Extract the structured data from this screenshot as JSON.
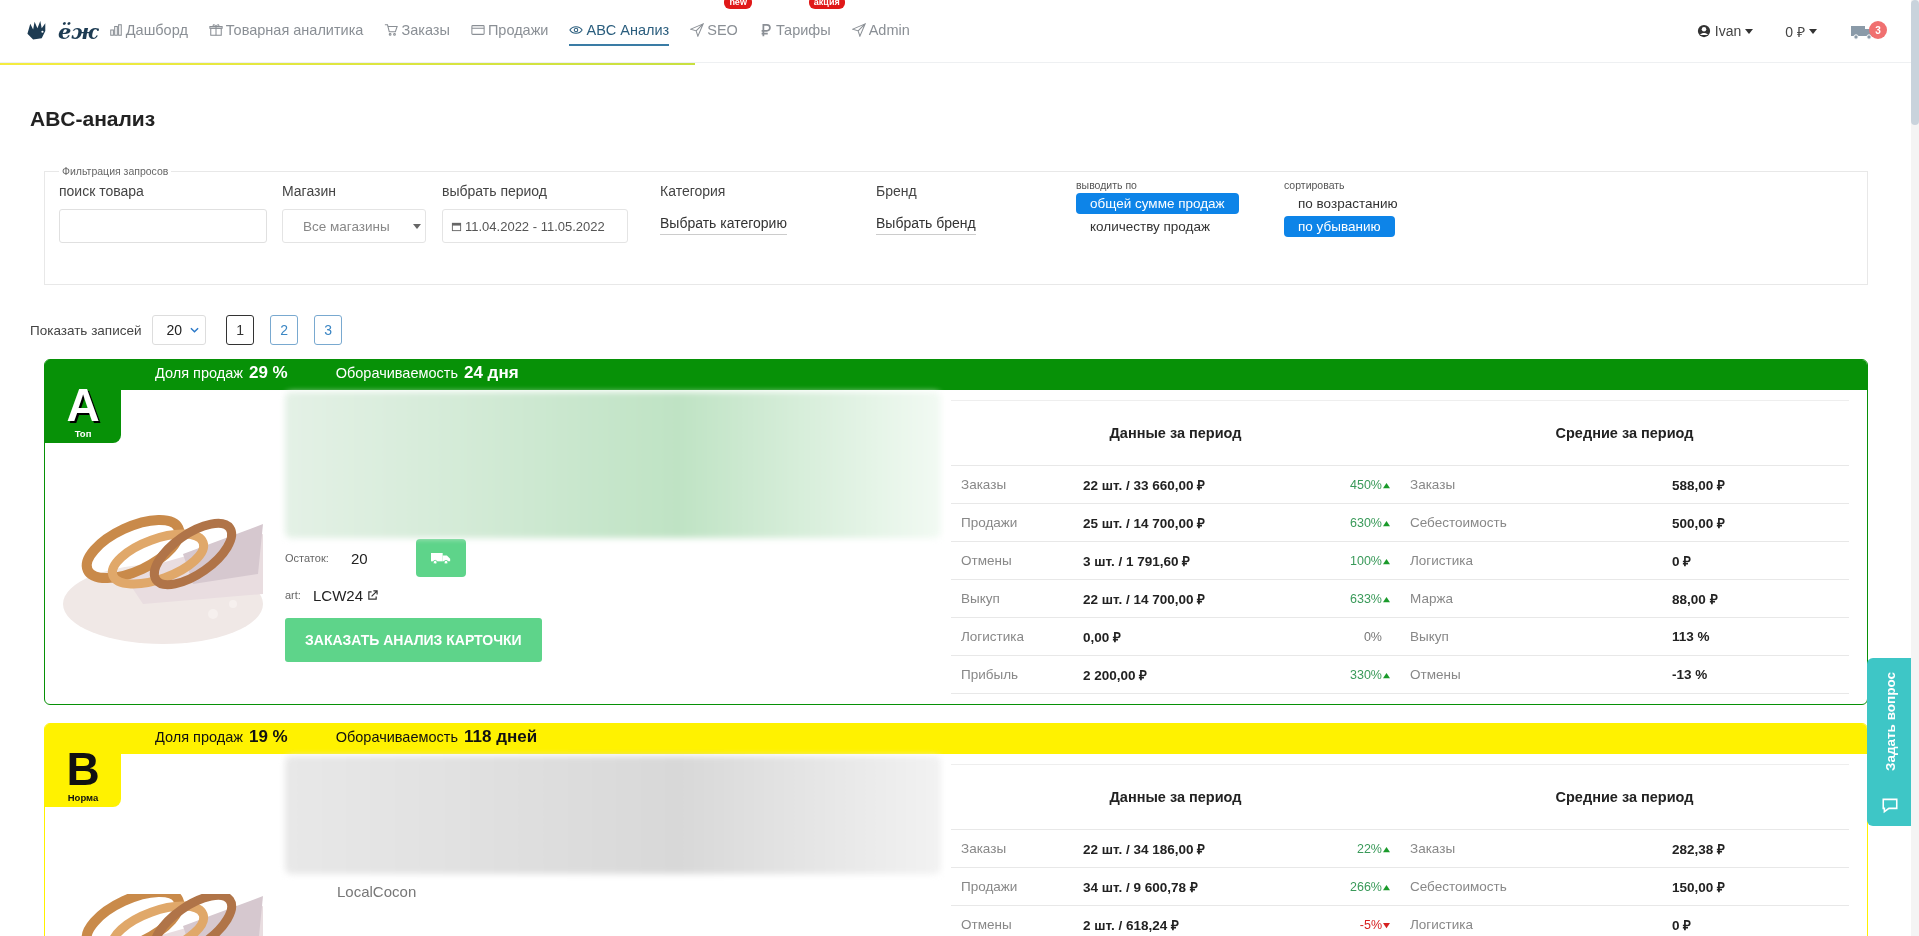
{
  "nav": {
    "items": [
      {
        "label": "Дашборд",
        "selected": false
      },
      {
        "label": "Товарная аналитика",
        "selected": false
      },
      {
        "label": "Заказы",
        "selected": false
      },
      {
        "label": "Продажи",
        "selected": false
      },
      {
        "label": "ABC Анализ",
        "selected": true
      },
      {
        "label": "SEO",
        "selected": false,
        "badge": "new"
      },
      {
        "label": "Тарифы",
        "selected": false,
        "badge": "акция"
      },
      {
        "label": "Admin",
        "selected": false
      }
    ],
    "logo": "ёж",
    "user": "Ivan",
    "balance": "0 ₽",
    "cart_count": "3"
  },
  "page_title": "ABC-анализ",
  "filters": {
    "legend": "Фильтрация запросов",
    "search": {
      "label": "поиск товара"
    },
    "store": {
      "label": "Магазин",
      "value": "Все магазины"
    },
    "period": {
      "label": "выбрать период",
      "value": "11.04.2022 - 11.05.2022"
    },
    "category": {
      "label": "Категория",
      "value": "Выбрать категорию"
    },
    "brand": {
      "label": "Бренд",
      "value": "Выбрать бренд"
    },
    "output": {
      "label": "выводить по",
      "options": [
        {
          "label": "общей сумме продаж",
          "selected": true
        },
        {
          "label": "количеству продаж",
          "selected": false
        }
      ]
    },
    "sort": {
      "label": "сортировать",
      "options": [
        {
          "label": "по возрастанию",
          "selected": false
        },
        {
          "label": "по убыванию",
          "selected": true
        }
      ]
    }
  },
  "pagination": {
    "label": "Показать записей",
    "page_size": "20",
    "pages": [
      {
        "label": "1",
        "selected": true
      },
      {
        "label": "2",
        "selected": false
      },
      {
        "label": "3",
        "selected": false
      }
    ]
  },
  "cards": [
    {
      "grade": "A",
      "grade_label": "Топ",
      "color": "#079107",
      "share_label": "Доля продаж",
      "share": "29 %",
      "turnover_label": "Оборачиваемость",
      "turnover": "24 дня",
      "stock_label": "Остаток:",
      "stock": "20",
      "art_label": "art:",
      "art": "LCW24",
      "order_button": "ЗАКАЗАТЬ АНАЛИЗ КАРТОЧКИ",
      "period": {
        "title": "Данные за период",
        "rows": [
          {
            "label": "Заказы",
            "value": "22 шт. / 33 660,00 ₽",
            "change": "450%",
            "kind": "up"
          },
          {
            "label": "Продажи",
            "value": "25 шт. / 14 700,00 ₽",
            "change": "630%",
            "kind": "up"
          },
          {
            "label": "Отмены",
            "value": "3 шт. / 1 791,60 ₽",
            "change": "100%",
            "kind": "up"
          },
          {
            "label": "Выкуп",
            "value": "22 шт. / 14 700,00 ₽",
            "change": "633%",
            "kind": "up"
          },
          {
            "label": "Логистика",
            "value": "0,00 ₽",
            "change": "0%",
            "kind": "flat"
          },
          {
            "label": "Прибыль",
            "value": "2 200,00 ₽",
            "change": "330%",
            "kind": "up"
          }
        ]
      },
      "averages": {
        "title": "Средние за период",
        "rows": [
          {
            "label": "Заказы",
            "value": "588,00 ₽"
          },
          {
            "label": "Себестоимость",
            "value": "500,00 ₽"
          },
          {
            "label": "Логистика",
            "value": "0 ₽"
          },
          {
            "label": "Маржа",
            "value": "88,00 ₽"
          },
          {
            "label": "Выкуп",
            "value": "113 %"
          },
          {
            "label": "Отмены",
            "value": "-13 %"
          }
        ]
      }
    },
    {
      "grade": "B",
      "grade_label": "Норма",
      "color": "#fff200",
      "share_label": "Доля продаж",
      "share": "19 %",
      "turnover_label": "Оборачиваемость",
      "turnover": "118 дней",
      "brand": "LocalCocon",
      "period": {
        "title": "Данные за период",
        "rows": [
          {
            "label": "Заказы",
            "value": "22 шт. / 34 186,00 ₽",
            "change": "22%",
            "kind": "up"
          },
          {
            "label": "Продажи",
            "value": "34 шт. / 9 600,78 ₽",
            "change": "266%",
            "kind": "up"
          },
          {
            "label": "Отмены",
            "value": "2 шт. / 618,24 ₽",
            "change": "-5%",
            "kind": "down"
          }
        ]
      },
      "averages": {
        "title": "Средние за период",
        "rows": [
          {
            "label": "Заказы",
            "value": "282,38 ₽"
          },
          {
            "label": "Себестоимость",
            "value": "150,00 ₽"
          },
          {
            "label": "Логистика",
            "value": "0 ₽"
          }
        ]
      }
    }
  ],
  "help_tab": "Задать вопрос"
}
